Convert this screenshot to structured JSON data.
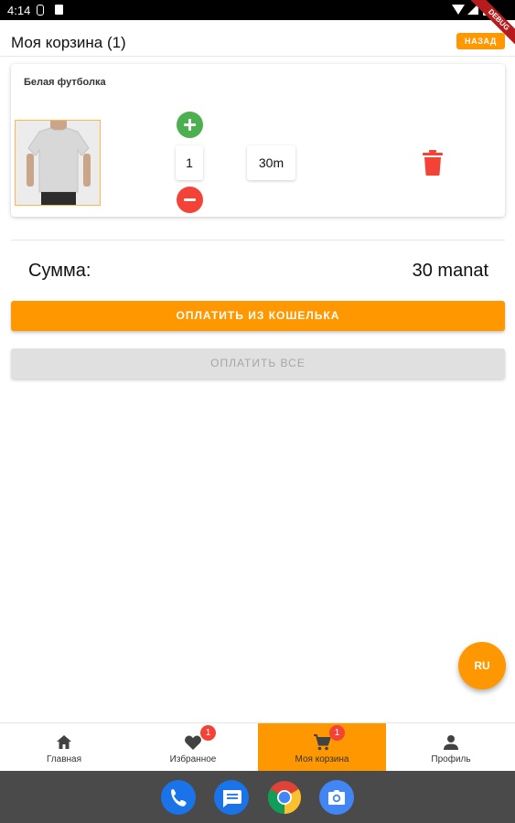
{
  "status_bar": {
    "time": "4:14"
  },
  "debug_ribbon": "DEBUG",
  "header": {
    "title": "Моя корзина (1)",
    "back_label": "НАЗАД"
  },
  "cart": {
    "items": [
      {
        "name": "Белая футболка",
        "quantity": "1",
        "price": "30m"
      }
    ]
  },
  "summary": {
    "label": "Сумма:",
    "value": "30 manat"
  },
  "buttons": {
    "pay_wallet": "ОПЛАТИТЬ ИЗ КОШЕЛЬКА",
    "pay_all": "ОПЛАТИТЬ ВСЕ"
  },
  "fab": {
    "language": "RU"
  },
  "bottom_nav": {
    "items": [
      {
        "label": "Главная",
        "icon": "home-icon"
      },
      {
        "label": "Избранное",
        "icon": "heart-icon",
        "badge": "1"
      },
      {
        "label": "Моя корзина",
        "icon": "cart-icon",
        "badge": "1",
        "active": true
      },
      {
        "label": "Профиль",
        "icon": "person-icon"
      }
    ]
  },
  "dock_apps": [
    "phone-icon",
    "messages-icon",
    "chrome-icon",
    "camera-icon"
  ],
  "colors": {
    "accent": "#ff9800",
    "add": "#4caf50",
    "remove": "#f44336",
    "badge": "#f44336",
    "disabled_button": "#e0e0e0"
  }
}
